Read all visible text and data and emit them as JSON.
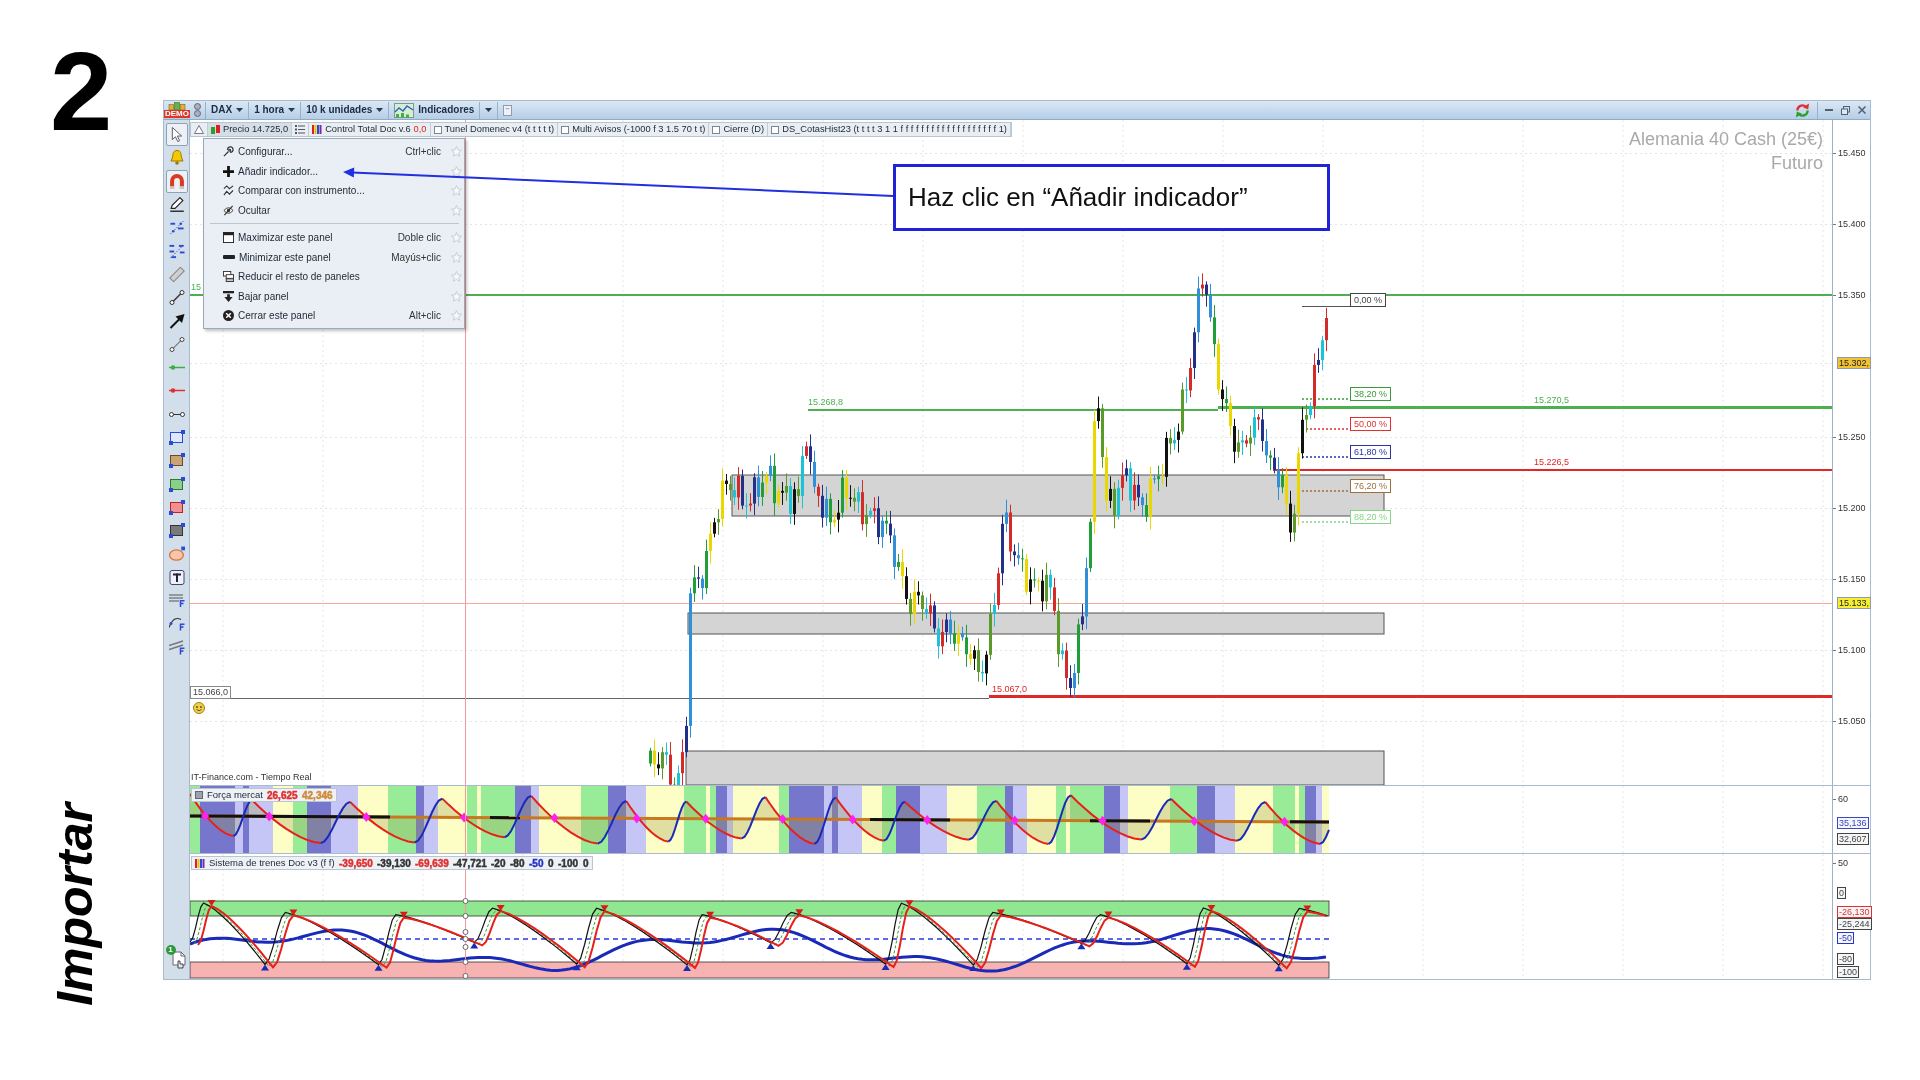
{
  "step": {
    "number": "2",
    "caption": "Importar"
  },
  "toolbar": {
    "badge": "DEMO",
    "instrument": "DAX",
    "period": "1 hora",
    "units": "10 k unidades",
    "indicators": "Indicadores"
  },
  "tools": [
    {
      "selected": true
    },
    {
      "selected": false
    },
    {
      "selected": true
    },
    {
      "selected": false
    },
    {
      "selected": false
    },
    {
      "selected": false
    },
    {
      "selected": false
    },
    {
      "selected": false
    },
    {
      "selected": false
    },
    {
      "selected": false
    },
    {
      "selected": false
    },
    {
      "selected": false
    },
    {
      "selected": false
    },
    {
      "selected": false
    },
    {
      "selected": false
    },
    {
      "selected": false
    },
    {
      "selected": false
    },
    {
      "selected": false
    },
    {
      "selected": false
    },
    {
      "selected": false
    },
    {
      "selected": false
    },
    {
      "selected": false
    },
    {
      "selected": false
    }
  ],
  "tool_footer": {
    "badge": "1"
  },
  "legend": [
    {
      "kind": "price",
      "label": "Precio 14.725,0"
    },
    {
      "kind": "indicator",
      "label": "Control Total Doc v.6",
      "value": "0,0"
    },
    {
      "kind": "toggle",
      "label": "Tunel Domenec v4 (t t t t t)",
      "checked": false
    },
    {
      "kind": "toggle",
      "label": "Multi Avisos (-1000 f 3 1.5 70 t t)",
      "checked": false
    },
    {
      "kind": "toggle",
      "label": "Cierre (D)",
      "checked": false
    },
    {
      "kind": "toggle",
      "label": "DS_CotasHist23 (t t t t 3 1 1 f f f f f f f f f f f f f f f f f f f 1)",
      "checked": false
    }
  ],
  "menu": {
    "groups": [
      [
        {
          "label": "Configurar...",
          "shortcut": "Ctrl+clic",
          "favorite": false
        },
        {
          "label": "Añadir indicador...",
          "favorite": false
        },
        {
          "label": "Comparar con instrumento...",
          "favorite": false
        },
        {
          "label": "Ocultar",
          "favorite": false
        }
      ],
      [
        {
          "label": "Maximizar este panel",
          "shortcut": "Doble clic",
          "favorite": false
        },
        {
          "label": "Minimizar este panel",
          "shortcut": "Mayús+clic",
          "favorite": false
        },
        {
          "label": "Reducir el resto de paneles",
          "favorite": false
        },
        {
          "label": "Bajar panel",
          "favorite": false
        },
        {
          "label": "Cerrar este panel",
          "shortcut": "Alt+clic",
          "favorite": false
        }
      ]
    ]
  },
  "callout": {
    "text": "Haz clic en “Añadir indicador”"
  },
  "chart": {
    "title": "Alemania 40 Cash (25€)",
    "subtitle": "Futuro",
    "axis": [
      {
        "kind": "tick",
        "label": "15.450"
      },
      {
        "kind": "tick",
        "label": "15.400"
      },
      {
        "kind": "tick",
        "label": "15.350"
      },
      {
        "kind": "marker",
        "label": "15.302,",
        "color": "#f2c232"
      },
      {
        "kind": "tick",
        "label": "15.250"
      },
      {
        "kind": "tick",
        "label": "15.200"
      },
      {
        "kind": "tick",
        "label": "15.150"
      },
      {
        "kind": "marker",
        "label": "15.133,",
        "color": "#f7f032"
      },
      {
        "kind": "tick",
        "label": "15.100"
      },
      {
        "kind": "tick",
        "label": "15.050"
      }
    ],
    "levels": [
      {
        "label": "15",
        "color": "#4cb050"
      },
      {
        "label": "15.268,8",
        "color": "#4cb050"
      },
      {
        "label": "15.270,5",
        "color": "#4cb050"
      },
      {
        "label": "15.226,5",
        "color": "#e02828"
      },
      {
        "label": "15.067,0",
        "color": "#e02828"
      },
      {
        "label": "15.066,0",
        "color": "#666666"
      }
    ],
    "fib_levels": [
      {
        "label": "0,00 %",
        "color": "#444444"
      },
      {
        "label": "38,20 %",
        "color": "#3a9a3a"
      },
      {
        "label": "50,00 %",
        "color": "#e03030"
      },
      {
        "label": "61,80 %",
        "color": "#2a35a5"
      },
      {
        "label": "76,20 %",
        "color": "#a0703a"
      },
      {
        "label": "88,20 %",
        "color": "#86d486"
      }
    ],
    "source": "IT-Finance.com - Tiempo Real"
  },
  "panels": [
    {
      "kind": "bands",
      "name": "Força mercat",
      "values": [
        {
          "text": "26,625",
          "color": "#e03030"
        },
        {
          "text": "42,346",
          "color": "#d08a3a"
        }
      ],
      "axis": [
        {
          "kind": "tick",
          "label": "60"
        },
        {
          "kind": "marker",
          "label": "35,136",
          "color": "#3a45c8"
        },
        {
          "kind": "marker",
          "label": "32,607",
          "color": "#444444"
        }
      ]
    },
    {
      "kind": "trains",
      "name": "Sistema de trenes Doc v3 (f f)",
      "values": [
        {
          "text": "-39,650",
          "color": "#e03030"
        },
        {
          "text": "-39,130",
          "color": "#333333"
        },
        {
          "text": "-69,639",
          "color": "#e03030"
        },
        {
          "text": "-47,721",
          "color": "#333333"
        },
        {
          "text": "-20",
          "color": "#333333"
        },
        {
          "text": "-80",
          "color": "#333333"
        },
        {
          "text": "-50",
          "color": "#2a35c8"
        },
        {
          "text": "0",
          "color": "#333333"
        },
        {
          "text": "-100",
          "color": "#333333"
        },
        {
          "text": "0",
          "color": "#333333"
        }
      ],
      "axis": [
        {
          "kind": "tick",
          "label": "50"
        },
        {
          "kind": "marker",
          "label": "0",
          "color": "#444444"
        },
        {
          "kind": "marker",
          "label": "-26,130",
          "color": "#e03030"
        },
        {
          "kind": "marker",
          "label": "-25,244",
          "color": "#444444"
        },
        {
          "kind": "marker",
          "label": "-50",
          "color": "#2a35c8"
        },
        {
          "kind": "marker",
          "label": "-80",
          "color": "#444444"
        },
        {
          "kind": "marker",
          "label": "-100",
          "color": "#444444"
        }
      ]
    }
  ]
}
